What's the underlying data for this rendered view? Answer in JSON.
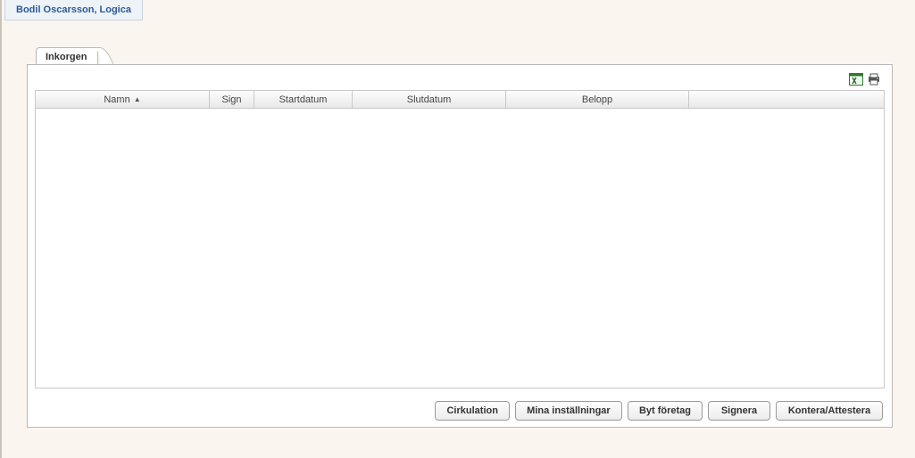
{
  "user_badge": "Bodil Oscarsson, Logica",
  "tabs": {
    "inbox": "Inkorgen"
  },
  "grid": {
    "columns": {
      "namn": "Namn",
      "sign": "Sign",
      "startdatum": "Startdatum",
      "slutdatum": "Slutdatum",
      "belopp": "Belopp"
    },
    "sorted_column": "namn",
    "sort_direction": "asc",
    "rows": []
  },
  "buttons": {
    "cirkulation": "Cirkulation",
    "mina_installningar": "Mina inställningar",
    "byt_foretag": "Byt företag",
    "signera": "Signera",
    "kontera_attestera": "Kontera/Attestera"
  },
  "icons": {
    "excel": "excel-icon",
    "print": "print-icon"
  }
}
